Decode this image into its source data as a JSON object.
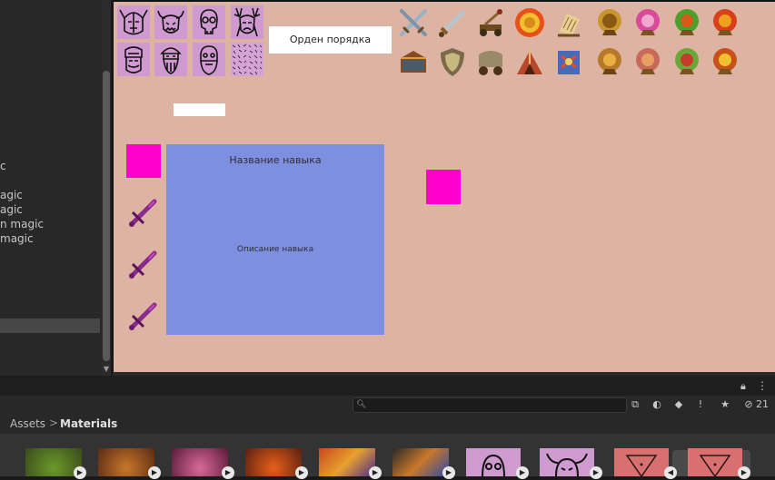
{
  "hierarchy": {
    "items": [
      "c",
      "agic",
      "agic",
      "n magic",
      "magic"
    ]
  },
  "game_view": {
    "order_label": "Орден порядка",
    "skill_title": "Название навыка",
    "skill_description": "Описание навыка",
    "colors": {
      "background": "#ddb4a3",
      "panel": "#7f8fdf",
      "placeholder": "#ff00cc",
      "face_tile": "#cf9acf"
    },
    "face_icons": [
      "horned-helmet-face-icon",
      "horned-beast-face-icon",
      "skull-face-icon",
      "antlered-face-icon",
      "bearded-face-icon",
      "helmeted-beard-face-icon",
      "bald-beard-face-icon",
      "noise-pattern-icon"
    ],
    "skill_icons_row1": [
      "crossed-swords-icon",
      "sword-icon",
      "catapult-icon",
      "sun-emblem-icon",
      "scroll-stand-icon",
      "golden-orb-icon",
      "pink-orb-icon",
      "green-orb-icon",
      "fire-orb-icon"
    ],
    "skill_icons_row2": [
      "treasure-chest-icon",
      "shield-icon",
      "wagon-icon",
      "tent-icon",
      "spellbook-icon",
      "gold-relic-orb-icon",
      "rose-orb-icon",
      "emerald-orb-icon",
      "flame-orb-icon"
    ],
    "sword_icon": "magenta-crossed-swords-icon"
  },
  "project": {
    "breadcrumb_root": "Assets",
    "breadcrumb_separator": ">",
    "breadcrumb_current": "Materials",
    "hidden_count": "21",
    "search_placeholder": ""
  }
}
